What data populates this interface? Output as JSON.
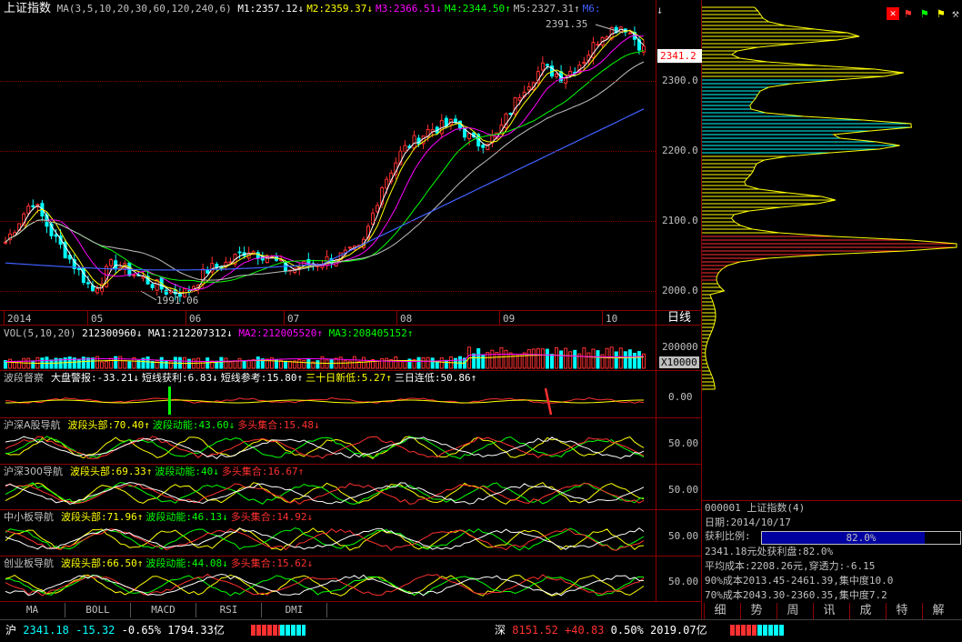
{
  "main": {
    "title": "上证指数",
    "ma_label": "MA(3,5,10,20,30,60,120,240,6)",
    "ma_values": [
      {
        "text": "M1:2357.12↓",
        "color": "#ffffff"
      },
      {
        "text": "M2:2359.37↓",
        "color": "#ffff00"
      },
      {
        "text": "M3:2366.51↓",
        "color": "#ff00ff"
      },
      {
        "text": "M4:2344.50↑",
        "color": "#00ff00"
      },
      {
        "text": "M5:2327.31↑",
        "color": "#c0c0c0"
      },
      {
        "text": "M6:",
        "color": "#4060ff"
      }
    ],
    "y_ticks": [
      "2300.0",
      "2200.0",
      "2100.0",
      "2000.0"
    ],
    "high_label": "2391.35",
    "low_label": "1991.06",
    "current_price": "2341.2",
    "x_ticks": [
      "2014",
      "05",
      "06",
      "07",
      "08",
      "09",
      "10"
    ],
    "period": "日线"
  },
  "vol": {
    "label": "VOL(5,10,20)",
    "value": "212300960↓",
    "ma1": "MA1:212207312↓",
    "ma2": "MA2:212005520↑",
    "ma3": "MA3:208405152↑",
    "y_tick": "200000",
    "unit": "X10000"
  },
  "panel1": {
    "name": "波段督察",
    "items": [
      {
        "text": "大盘警报:-33.21↓",
        "color": "#ffffff"
      },
      {
        "text": "短线获利:6.83↓",
        "color": "#ffffff"
      },
      {
        "text": "短线参考:15.80↑",
        "color": "#ffffff"
      },
      {
        "text": "三十日新低:5.27↑",
        "color": "#ffff00"
      },
      {
        "text": "三日连低:50.86↑",
        "color": "#ffffff"
      }
    ],
    "y_tick": "0.00"
  },
  "panel2": {
    "name": "沪深A股导航",
    "items": [
      {
        "text": "波段头部:70.40↑",
        "color": "#ffff00"
      },
      {
        "text": "波段动能:43.60↓",
        "color": "#00ff00"
      },
      {
        "text": "多头集合:15.48↓",
        "color": "#ff3030"
      }
    ],
    "y_tick": "50.00"
  },
  "panel3": {
    "name": "沪深300导航",
    "items": [
      {
        "text": "波段头部:69.33↑",
        "color": "#ffff00"
      },
      {
        "text": "波段动能:40↓",
        "color": "#00ff00"
      },
      {
        "text": "多头集合:16.67↑",
        "color": "#ff3030"
      }
    ],
    "y_tick": "50.00"
  },
  "panel4": {
    "name": "中小板导航",
    "items": [
      {
        "text": "波段头部:71.96↑",
        "color": "#ffff00"
      },
      {
        "text": "波段动能:46.13↓",
        "color": "#00ff00"
      },
      {
        "text": "多头集合:14.92↓",
        "color": "#ff3030"
      }
    ],
    "y_tick": "50.00"
  },
  "panel5": {
    "name": "创业板导航",
    "items": [
      {
        "text": "波段头部:66.50↑",
        "color": "#ffff00"
      },
      {
        "text": "波段动能:44.08↓",
        "color": "#00ff00"
      },
      {
        "text": "多头集合:15.62↓",
        "color": "#ff3030"
      }
    ],
    "y_tick": "50.00"
  },
  "bottom_tabs": [
    "MA",
    "BOLL",
    "MACD",
    "RSI",
    "DMI"
  ],
  "chip": {
    "code_name": "000001 上证指数(4)",
    "date": "日期:2014/10/17",
    "profit_label": "获利比例:",
    "profit_value": "82.0%",
    "profit_ratio": 0.82,
    "lines": [
      "2341.18元处获利盘:82.0%",
      "平均成本:2208.26元,穿透力:-6.15",
      "90%成本2013.45-2461.39,集中度10.0",
      "70%成本2043.30-2360.35,集中度7.2"
    ]
  },
  "right_tabs": [
    "细",
    "势",
    "周",
    "讯",
    "成",
    "特",
    "解"
  ],
  "status": {
    "sh_label": "沪",
    "sh_price": "2341.18",
    "sh_change": "-15.32",
    "sh_pct": "-0.65%",
    "sh_amount": "1794.33亿",
    "sz_label": "深",
    "sz_price": "8151.52",
    "sz_change": "+40.83",
    "sz_pct": "0.50%",
    "sz_amount": "2019.07亿"
  },
  "colors": {
    "up": "#ff3030",
    "down": "#00ffff",
    "frame": "#8b0000",
    "ma1": "#ffffff",
    "ma2": "#ffff00",
    "ma3": "#ff00ff",
    "ma4": "#00ff00",
    "ma5": "#c0c0c0",
    "ma6": "#4060ff"
  }
}
